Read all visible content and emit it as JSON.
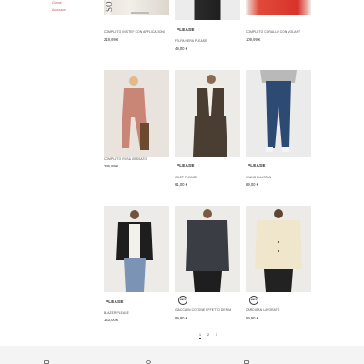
{
  "sidebar": {
    "links": [
      "Gonne",
      "Accessori"
    ]
  },
  "products": [
    {
      "name": "COMPLETO IN STEF CON APPLICAZIONI",
      "price": "219,99 €",
      "badge": "",
      "logo": ""
    },
    {
      "name": "FELPA NERA PLEASE",
      "price": "49,00 €",
      "badge": "PLEASE",
      "logo": ""
    },
    {
      "name": "COMPLETO CORALLO CON VOLANT",
      "price": "109,99 €",
      "badge": "",
      "logo": ""
    },
    {
      "name": "COMPLETO ROSA GESSATO",
      "price": "236,99 €",
      "badge": "",
      "logo": ""
    },
    {
      "name": "GILET PLEASE",
      "price": "61,00 €",
      "badge": "PLEASE",
      "logo": ""
    },
    {
      "name": "JEANS ELLISTAN",
      "price": "69,00 €",
      "badge": "PLEASE",
      "logo": ""
    },
    {
      "name": "BLAZER PLEASE",
      "price": "143,00 €",
      "badge": "PLEASE",
      "logo": ""
    },
    {
      "name": "GIACCA IN COTONE EFFETTO DENIM",
      "price": "89,90 €",
      "badge": "",
      "logo": "MAPE"
    },
    {
      "name": "CARDIGAN LAVORATO",
      "price": "59,90 €",
      "badge": "",
      "logo": "MAPE"
    }
  ],
  "pagination": [
    "1",
    "2",
    "3"
  ],
  "colors": {
    "accent": "#c0566e",
    "footer_bg": "#f4f4f4"
  }
}
